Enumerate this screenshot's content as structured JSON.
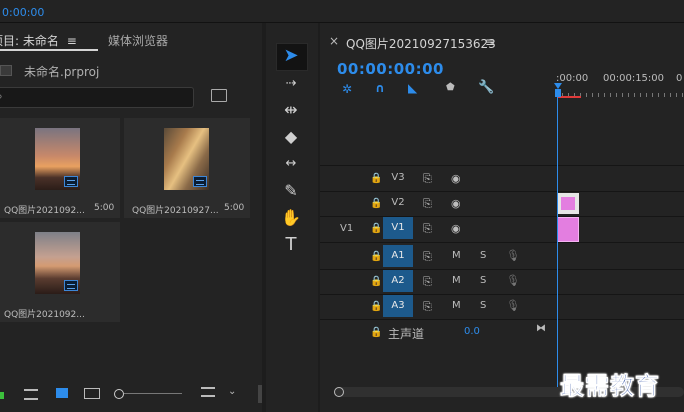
{
  "top": {
    "timecode": "0:00:00"
  },
  "project": {
    "tab_title": "项目: 未命名",
    "tab_menu": "≡",
    "media_browser": "媒体浏览器",
    "project_file": "未命名.prproj",
    "search_placeholder": "",
    "items": [
      {
        "name": "QQ图片2021092...",
        "duration": "5:00"
      },
      {
        "name": "QQ图片20210927...",
        "duration": "5:00"
      },
      {
        "name": "QQ图片2021092...",
        "duration": ""
      }
    ]
  },
  "timeline": {
    "sequence_title": "QQ图片20210927153623",
    "tab_menu": "≡",
    "close": "×",
    "timecode": "00:00:00:00",
    "ruler": [
      ":00:00",
      "00:00:15:00",
      "0"
    ],
    "tracks_video": [
      {
        "label": "V3",
        "source": ""
      },
      {
        "label": "V2",
        "source": ""
      },
      {
        "label": "V1",
        "source": "V1"
      }
    ],
    "tracks_audio": [
      {
        "label": "A1",
        "m": "M",
        "s": "S"
      },
      {
        "label": "A2",
        "m": "M",
        "s": "S"
      },
      {
        "label": "A3",
        "m": "M",
        "s": "S"
      }
    ],
    "master": {
      "label": "主声道",
      "value": "0.0"
    }
  },
  "watermark": "最需教育",
  "colors": {
    "accent": "#2d8ceb",
    "track_on": "#1d5a8c",
    "clip": "#e37ee0"
  }
}
